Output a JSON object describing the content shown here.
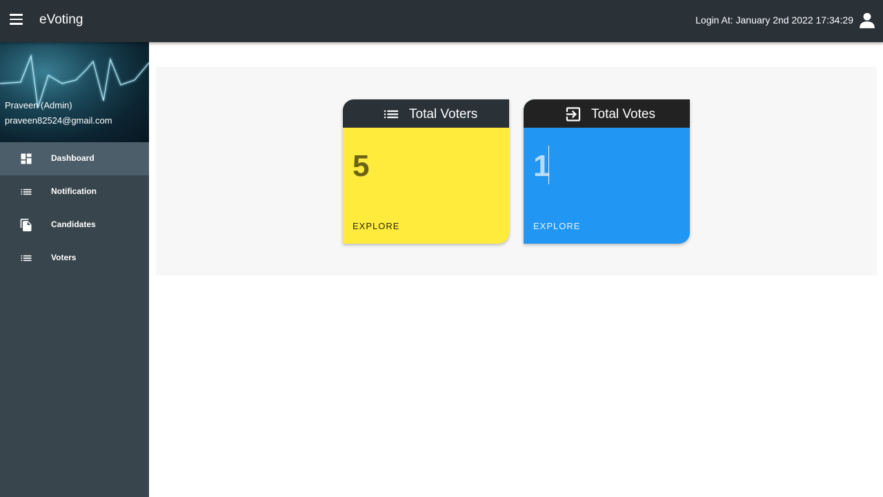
{
  "header": {
    "title": "eVoting",
    "login_text": "Login At: January 2nd 2022 17:34:29"
  },
  "sidebar": {
    "profile": {
      "name": "Praveen (Admin)",
      "email": "praveen82524@gmail.com"
    },
    "items": [
      {
        "label": "Dashboard",
        "icon": "dashboard-icon",
        "active": true
      },
      {
        "label": "Notification",
        "icon": "list-icon",
        "active": false
      },
      {
        "label": "Candidates",
        "icon": "file-copy-icon",
        "active": false
      },
      {
        "label": "Voters",
        "icon": "list-icon",
        "active": false
      }
    ]
  },
  "cards": [
    {
      "title": "Total Voters",
      "value": "5",
      "action": "EXPLORE",
      "icon": "list-icon",
      "color": "#ffeb3b",
      "header_color": "#2a3137"
    },
    {
      "title": "Total Votes",
      "value": "1",
      "action": "EXPLORE",
      "icon": "login-icon",
      "color": "#2196f3",
      "header_color": "#222222"
    }
  ],
  "colors": {
    "topbar": "#2a3137",
    "sidebar": "#38454d",
    "sidebar_active": "#4c5e69"
  }
}
